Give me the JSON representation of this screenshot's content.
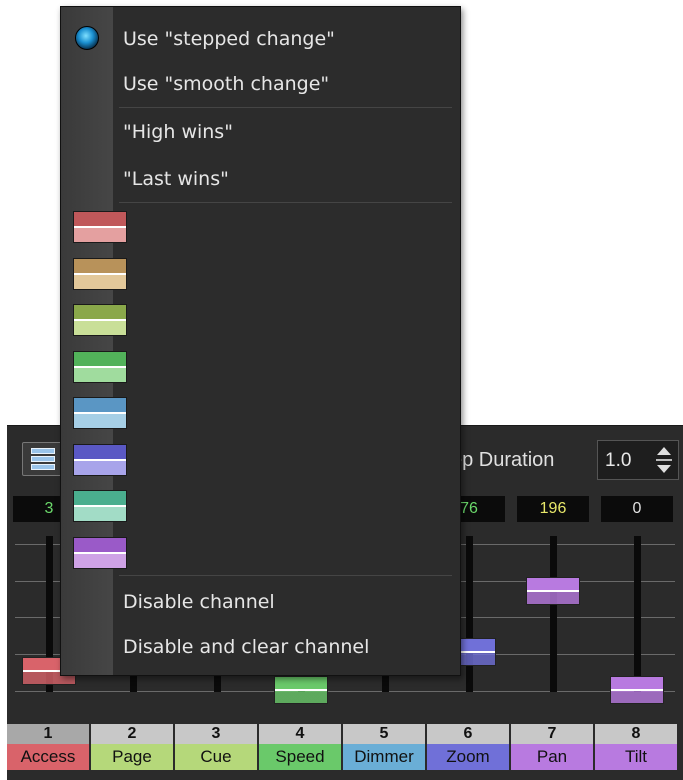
{
  "menu": {
    "items": [
      {
        "label": "Use \"stepped change\"",
        "selected": true
      },
      {
        "label": "Use \"smooth change\"",
        "selected": false
      },
      {
        "label": "\"High wins\""
      },
      {
        "label": "\"Last wins\""
      }
    ],
    "swatches": [
      {
        "name": "red",
        "dark": "#c0585a",
        "light": "#e4a0a0"
      },
      {
        "name": "tan",
        "dark": "#b8925a",
        "light": "#e3c89a"
      },
      {
        "name": "olive",
        "dark": "#8aa84a",
        "light": "#c9df98"
      },
      {
        "name": "green",
        "dark": "#52b25a",
        "light": "#a0dc9e"
      },
      {
        "name": "blue",
        "dark": "#5a96c4",
        "light": "#a6cfe6"
      },
      {
        "name": "indigo",
        "dark": "#5a58c4",
        "light": "#a8a4ea"
      },
      {
        "name": "teal",
        "dark": "#4aae8e",
        "light": "#a2dcc6"
      },
      {
        "name": "purple",
        "dark": "#9a5ac8",
        "light": "#cfa2e6"
      }
    ],
    "disable_channel": "Disable channel",
    "disable_and_clear": "Disable and clear channel"
  },
  "toolbar": {
    "icon": "list-settings-icon",
    "step_duration_label": "ep Duration",
    "step_duration_value": "1.0"
  },
  "values": [
    "3",
    "",
    "",
    "",
    "",
    "76",
    "196",
    "0"
  ],
  "value_colors": [
    "#6bd96b",
    "#6bd96b",
    "#6bd96b",
    "#6bd96b",
    "#6bd96b",
    "#6bd96b",
    "#e8e86a",
    "#e0e0e0"
  ],
  "channels": [
    {
      "num": "1",
      "name": "Access",
      "color": "#d9636a",
      "level": 0.15
    },
    {
      "num": "2",
      "name": "Page",
      "color": "#b5d87a",
      "level": null
    },
    {
      "num": "3",
      "name": "Cue",
      "color": "#b5d87a",
      "level": null
    },
    {
      "num": "4",
      "name": "Speed",
      "color": "#6ac96a",
      "level": 0.0
    },
    {
      "num": "5",
      "name": "Dimmer",
      "color": "#6aaed6",
      "level": null
    },
    {
      "num": "6",
      "name": "Zoom",
      "color": "#7070d8",
      "level": 0.3
    },
    {
      "num": "7",
      "name": "Pan",
      "color": "#b87ae0",
      "level": 0.77
    },
    {
      "num": "8",
      "name": "Tilt",
      "color": "#b87ae0",
      "level": 0.0
    }
  ]
}
